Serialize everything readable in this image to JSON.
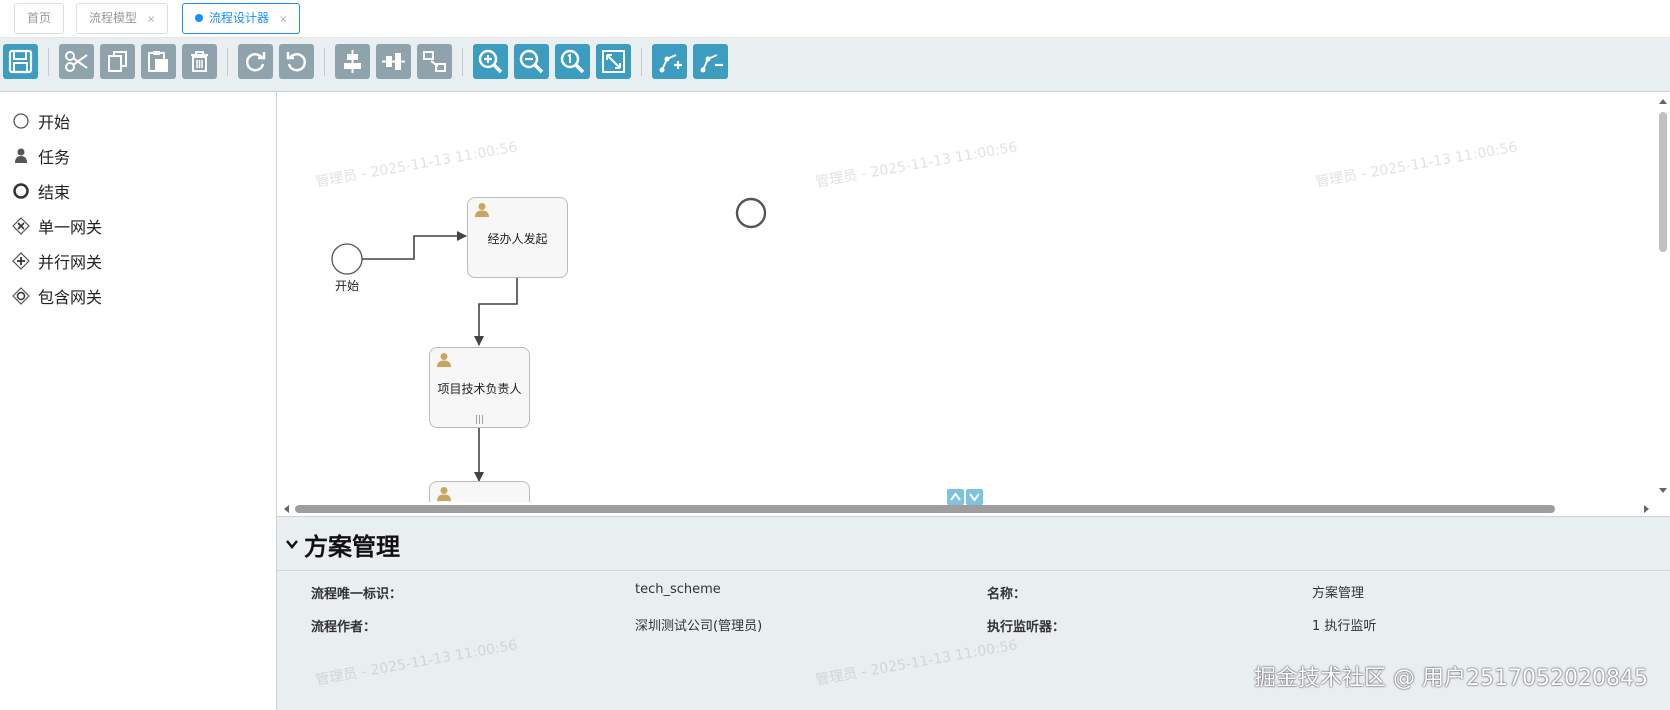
{
  "tabs": [
    {
      "label": "首页"
    },
    {
      "label": "流程模型",
      "close": "×"
    },
    {
      "label": "流程设计器",
      "close": "×"
    }
  ],
  "toolbar": {
    "buttons": [
      "save-icon",
      "cut-icon",
      "copy-icon",
      "paste-icon",
      "delete-icon",
      "redo-icon",
      "undo-icon",
      "align-horizontal-icon",
      "align-vertical-icon",
      "same-size-icon",
      "zoom-in-icon",
      "zoom-out-icon",
      "zoom-actual-icon",
      "zoom-fit-icon",
      "add-bendpoint-icon",
      "remove-bendpoint-icon"
    ]
  },
  "palette": {
    "items": [
      {
        "label": "开始",
        "icon": "circle-icon"
      },
      {
        "label": "任务",
        "icon": "user-icon"
      },
      {
        "label": "结束",
        "icon": "bold-circle-icon"
      },
      {
        "label": "单一网关",
        "icon": "exclusive-gateway-icon"
      },
      {
        "label": "并行网关",
        "icon": "parallel-gateway-icon"
      },
      {
        "label": "包含网关",
        "icon": "inclusive-gateway-icon"
      }
    ]
  },
  "canvas": {
    "watermark": "管理员 - 2025-11-13 11:00:56",
    "start_label": "开始",
    "tasks": [
      {
        "label": "经办人发起"
      },
      {
        "label": "项目技术负责人",
        "marker": "|||"
      }
    ]
  },
  "properties": {
    "title": "方案管理",
    "fields": [
      {
        "label": "流程唯一标识：",
        "value": "tech_scheme"
      },
      {
        "label": "名称：",
        "value": "方案管理"
      },
      {
        "label": "流程作者：",
        "value": "深圳测试公司(管理员)"
      },
      {
        "label": "执行监听器：",
        "value": "1 执行监听"
      }
    ]
  },
  "footer": {
    "brand": "掘金技术社区 @ 用户2517052020845"
  },
  "colors": {
    "accent": "#1890ff",
    "toolbar_blue": "#3c9dc0",
    "toolbar_gray": "#8ea3ab",
    "user_icon": "#c8a660"
  }
}
